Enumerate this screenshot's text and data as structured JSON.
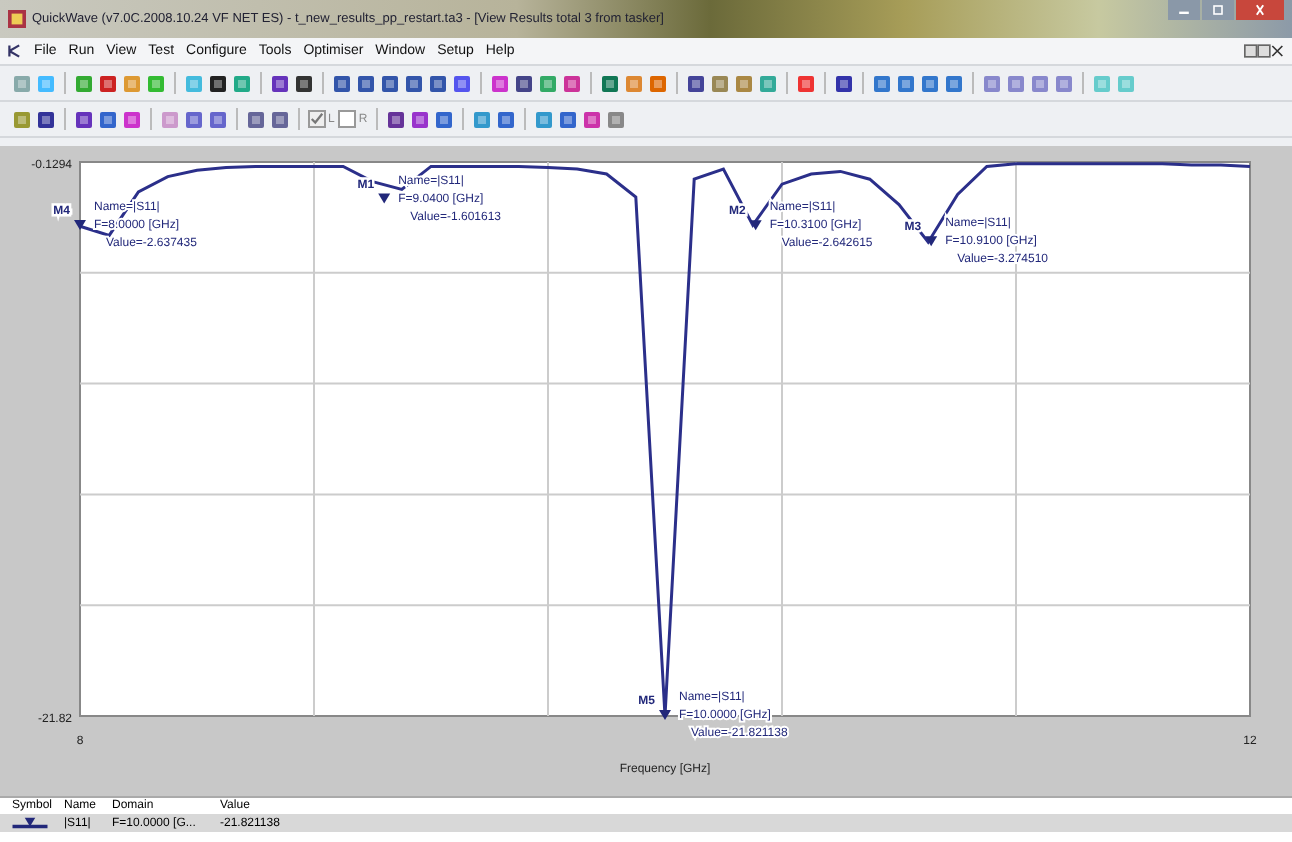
{
  "window": {
    "title": "QuickWave (v7.0C.2008.10.24 VF NET ES) - t_new_results_pp_restart.ta3 - [View Results total 3 from tasker]"
  },
  "menu": [
    "File",
    "Run",
    "View",
    "Test",
    "Configure",
    "Tools",
    "Optimiser",
    "Window",
    "Setup",
    "Help"
  ],
  "toolbar_checkboxes": [
    {
      "label": "L",
      "checked": true
    },
    {
      "label": "R",
      "checked": false
    }
  ],
  "plot": {
    "chart_data": {
      "type": "line",
      "xlabel": "Frequency [GHz]",
      "xlim": [
        8,
        12
      ],
      "ylim": [
        -21.82,
        -0.1294
      ],
      "xticks": [
        8,
        12
      ],
      "yticks": [
        {
          "value": -0.1294,
          "label": "-0.1294"
        },
        {
          "value": -21.82,
          "label": "-21.82"
        }
      ],
      "x": [
        8.0,
        8.1,
        8.2,
        8.3,
        8.4,
        8.5,
        8.6,
        8.7,
        8.8,
        8.9,
        9.0,
        9.1,
        9.2,
        9.3,
        9.4,
        9.5,
        9.6,
        9.7,
        9.8,
        9.9,
        10.0,
        10.1,
        10.2,
        10.3,
        10.4,
        10.5,
        10.6,
        10.7,
        10.8,
        10.9,
        11.0,
        11.1,
        11.2,
        11.3,
        11.4,
        11.5,
        11.6,
        11.7,
        11.8,
        11.9,
        12.0
      ],
      "series": [
        {
          "name": "|S11|",
          "color": "#2b2f8a",
          "values": [
            -2.64,
            -3.0,
            -1.3,
            -0.7,
            -0.45,
            -0.35,
            -0.3,
            -0.3,
            -0.3,
            -0.3,
            -0.9,
            -1.2,
            -0.3,
            -0.3,
            -0.3,
            -0.3,
            -0.35,
            -0.4,
            -0.6,
            -1.5,
            -21.82,
            -0.8,
            -0.4,
            -2.6,
            -1.0,
            -0.6,
            -0.5,
            -0.8,
            -1.8,
            -3.27,
            -1.4,
            -0.3,
            -0.2,
            -0.2,
            -0.2,
            -0.2,
            -0.2,
            -0.2,
            -0.25,
            -0.25,
            -0.3
          ]
        }
      ],
      "annotations": [
        {
          "x": 8.0,
          "y": -2.637435,
          "text": "M4"
        },
        {
          "x": 9.04,
          "y": -1.601613,
          "text": "M1"
        },
        {
          "x": 10.31,
          "y": -2.642615,
          "text": "M2"
        },
        {
          "x": 10.91,
          "y": -3.27451,
          "text": "M3"
        },
        {
          "x": 10.0,
          "y": -21.821138,
          "text": "M5"
        }
      ]
    },
    "marker_readouts": [
      {
        "lines": [
          "Name=|S11|",
          "F=8.0000 [GHz]",
          "Value=-2.637435"
        ]
      },
      {
        "lines": [
          "Name=|S11|",
          "F=9.0400 [GHz]",
          "Value=-1.601613"
        ]
      },
      {
        "lines": [
          "Name=|S11|",
          "F=10.3100 [GHz]",
          "Value=-2.642615"
        ]
      },
      {
        "lines": [
          "Name=|S11|",
          "F=10.9100 [GHz]",
          "Value=-3.274510"
        ]
      },
      {
        "lines": [
          "Name=|S11|",
          "F=10.0000 [GHz]",
          "Value=-21.821138"
        ]
      }
    ]
  },
  "legend": {
    "columns": [
      "Symbol",
      "Name",
      "Domain",
      "Value"
    ],
    "rows": [
      {
        "domain": "F=10.0000 [G...",
        "value": "-21.821138"
      }
    ]
  }
}
